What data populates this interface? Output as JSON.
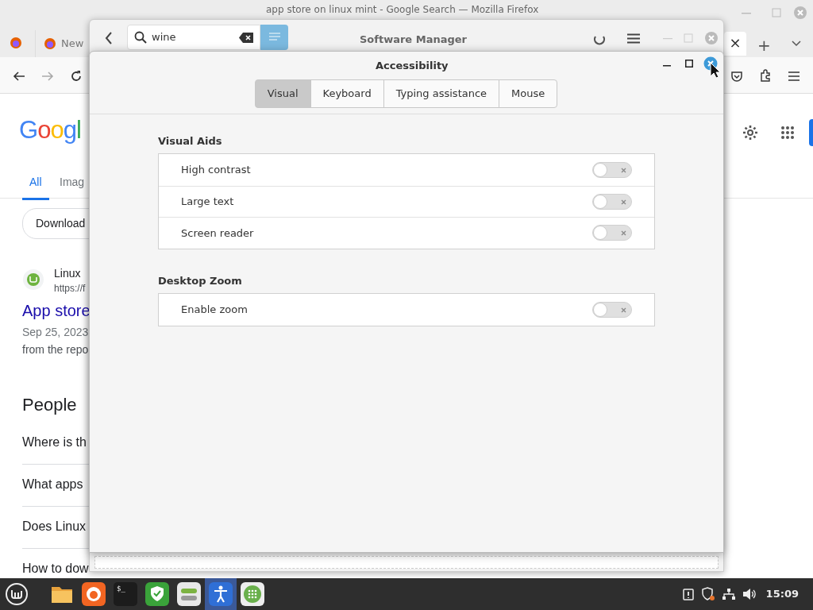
{
  "firefox": {
    "title": "app store on linux mint - Google Search — Mozilla Firefox",
    "tabs": [
      {
        "label": "New",
        "selected": false
      }
    ],
    "tab_close": "×",
    "new_tab": "+",
    "google": {
      "logo": "Googl",
      "nav": [
        {
          "label": "All",
          "selected": true
        },
        {
          "label": "Imag",
          "selected": false
        }
      ],
      "chip": "Download",
      "result": {
        "site": "Linux",
        "url": "https://f",
        "title": "App store",
        "date": "Sep 25, 2023",
        "snippet": "from the repo"
      },
      "paa_heading": "People",
      "questions": [
        "Where is th",
        "What apps",
        "Does Linux",
        "How to dow"
      ]
    }
  },
  "software_manager": {
    "title": "Software Manager",
    "search": {
      "value": "wine"
    }
  },
  "accessibility": {
    "title": "Accessibility",
    "tabs": [
      {
        "label": "Visual",
        "selected": true
      },
      {
        "label": "Keyboard",
        "selected": false
      },
      {
        "label": "Typing assistance",
        "selected": false
      },
      {
        "label": "Mouse",
        "selected": false
      }
    ],
    "sections": [
      {
        "title": "Visual Aids",
        "items": [
          {
            "label": "High contrast",
            "on": false
          },
          {
            "label": "Large text",
            "on": false
          },
          {
            "label": "Screen reader",
            "on": false
          }
        ]
      },
      {
        "title": "Desktop Zoom",
        "items": [
          {
            "label": "Enable zoom",
            "on": false
          }
        ]
      }
    ]
  },
  "taskbar": {
    "apps": [
      {
        "kind": "folder",
        "selected": false
      },
      {
        "kind": "firefox",
        "selected": false
      },
      {
        "kind": "terminal",
        "selected": false,
        "label": "$_"
      },
      {
        "kind": "shield",
        "selected": false
      },
      {
        "kind": "toggles",
        "selected": false
      },
      {
        "kind": "accessibility",
        "selected": true
      },
      {
        "kind": "grid",
        "selected": false
      }
    ],
    "clock": "15:09"
  }
}
